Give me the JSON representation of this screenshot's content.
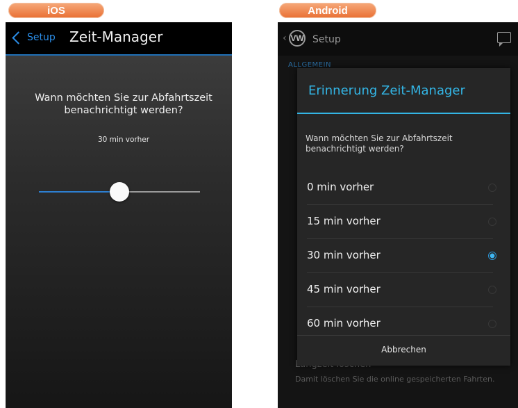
{
  "ios": {
    "tag": "iOS",
    "nav": {
      "back_label": "Setup",
      "title": "Zeit-Manager"
    },
    "question": "Wann möchten Sie zur Abfahrtszeit benachrichtigt werden?",
    "value_text": "30 min  vorher",
    "slider": {
      "fraction": 0.5
    },
    "colors": {
      "accent": "#2b8ee8",
      "background": "#2a2a2a"
    }
  },
  "android": {
    "tag": "Android",
    "actionbar": {
      "logo": "VW",
      "title": "Setup",
      "up_icon": "chevron-left-icon",
      "overflow_icon": "feedback-icon"
    },
    "section_label": "ALLGEMEIN",
    "background_item": {
      "title": "Langzeit löschen",
      "desc": "Damit löschen Sie die online gespeicherten Fahrten."
    },
    "dialog": {
      "title": "Erinnerung Zeit-Manager",
      "message": "Wann möchten Sie zur Abfahrtszeit benachrichtigt werden?",
      "options": [
        {
          "label": "0 min vorher",
          "selected": false
        },
        {
          "label": "15 min vorher",
          "selected": false
        },
        {
          "label": "30 min vorher",
          "selected": true
        },
        {
          "label": "45 min vorher",
          "selected": false
        },
        {
          "label": "60 min vorher",
          "selected": false
        }
      ],
      "cancel_label": "Abbrechen"
    },
    "colors": {
      "accent": "#33b5e5",
      "dialog_bg": "#262626"
    }
  }
}
